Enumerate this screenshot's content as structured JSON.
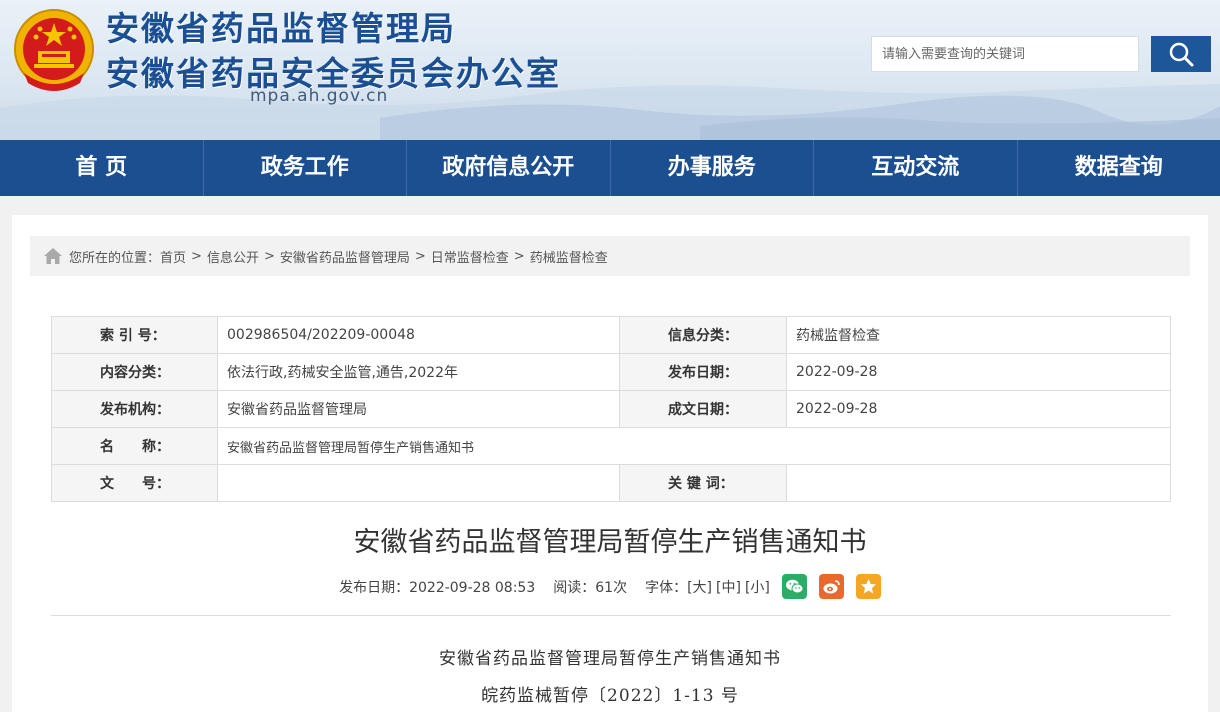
{
  "header": {
    "title_line1": "安徽省药品监督管理局",
    "title_line2": "安徽省药品安全委员会办公室",
    "domain": "mpa.ah.gov.cn",
    "search_placeholder": "请输入需要查询的关键词"
  },
  "nav": {
    "items": [
      "首 页",
      "政务工作",
      "政府信息公开",
      "办事服务",
      "互动交流",
      "数据查询"
    ]
  },
  "breadcrumb": {
    "prefix": "您所在的位置：",
    "items": [
      "首页",
      "信息公开",
      "安徽省药品监督管理局",
      "日常监督检查",
      "药械监督检查"
    ],
    "separator": ">"
  },
  "info_table": {
    "index_label": "索 引 号：",
    "index_value": "002986504/202209-00048",
    "category_label": "信息分类：",
    "category_value": "药械监督检查",
    "content_label": "内容分类：",
    "content_value": "依法行政,药械安全监管,通告,2022年",
    "publish_date_label": "发布日期：",
    "publish_date_value": "2022-09-28",
    "org_label": "发布机构：",
    "org_value": "安徽省药品监督管理局",
    "written_date_label": "成文日期：",
    "written_date_value": "2022-09-28",
    "name_label": "名　　称：",
    "name_value": "安徽省药品监督管理局暂停生产销售通知书",
    "docno_label": "文　　号：",
    "docno_value": "",
    "keywords_label": "关 键 词：",
    "keywords_value": ""
  },
  "article": {
    "title": "安徽省药品监督管理局暂停生产销售通知书",
    "meta_date": "发布日期：2022-09-28 08:53",
    "meta_reads": "阅读：61次",
    "meta_font_label": "字体：",
    "font_large": "[大]",
    "font_medium": "[中]",
    "font_small": "[小]",
    "body_line1": "安徽省药品监督管理局暂停生产销售通知书",
    "body_line2": "皖药监械暂停〔2022〕1-13 号"
  },
  "colors": {
    "nav_bg": "#1c4f90",
    "title_blue": "#1b4f93",
    "wechat": "#2aae67",
    "weibo": "#e9692c",
    "favorite": "#f5a623"
  },
  "icons": [
    "national-emblem",
    "search-icon",
    "home-icon",
    "wechat-icon",
    "weibo-icon",
    "favorite-star-icon"
  ]
}
